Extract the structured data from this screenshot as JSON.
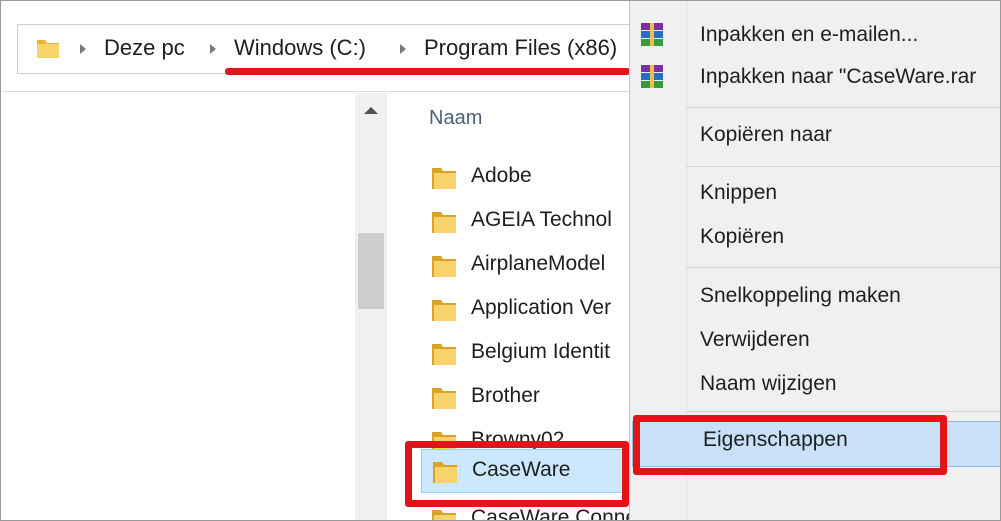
{
  "breadcrumb": {
    "items": [
      "Deze pc",
      "Windows (C:)",
      "Program Files (x86)"
    ]
  },
  "file_list": {
    "column_header": "Naam",
    "items": [
      {
        "name": "Adobe"
      },
      {
        "name": "AGEIA Technol"
      },
      {
        "name": "AirplaneModel"
      },
      {
        "name": "Application Ver"
      },
      {
        "name": "Belgium Identit"
      },
      {
        "name": "Brother"
      },
      {
        "name": "Browny02"
      },
      {
        "name": "CaseWare",
        "selected": true
      },
      {
        "name": "CaseWare Connector"
      }
    ]
  },
  "context_menu": {
    "items": [
      {
        "label": "Inpakken en e-mailen...",
        "icon": "winrar-icon"
      },
      {
        "label": "Inpakken naar \"CaseWare.rar",
        "icon": "winrar-icon"
      },
      {
        "label": "Kopiëren naar"
      },
      {
        "label": "Knippen"
      },
      {
        "label": "Kopiëren"
      },
      {
        "label": "Snelkoppeling maken"
      },
      {
        "label": "Verwijderen"
      },
      {
        "label": "Naam wijzigen"
      },
      {
        "label": "Eigenschappen",
        "highlighted": true
      }
    ]
  },
  "colors": {
    "annotation_red": "#e0141a",
    "selection_blue": "#cce8ff",
    "menu_highlight": "#c8e0f8"
  }
}
